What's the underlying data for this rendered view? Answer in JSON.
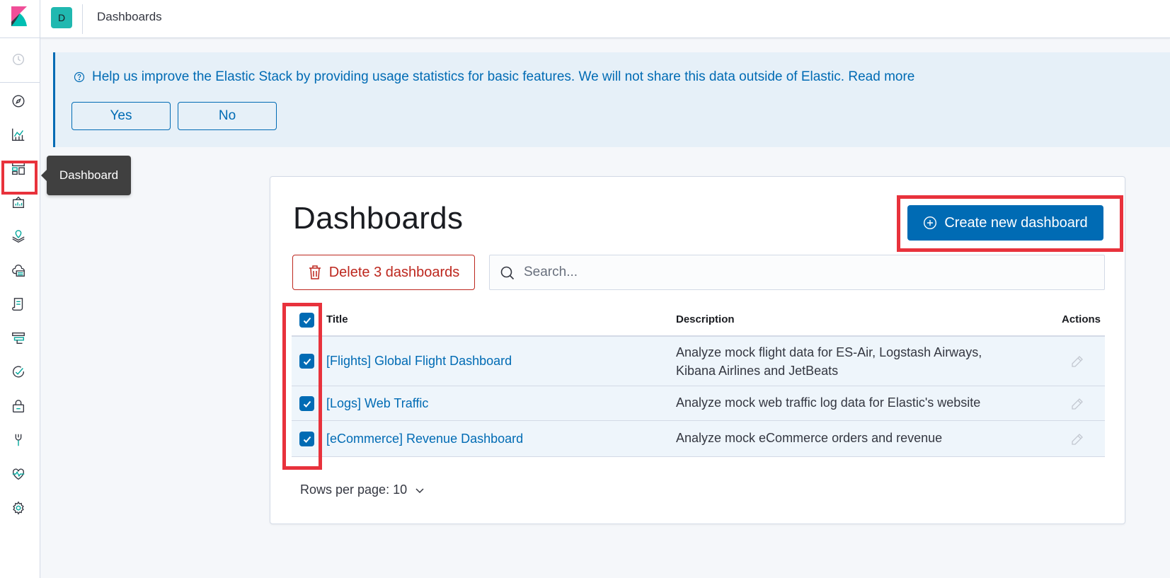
{
  "header": {
    "space_initial": "D",
    "breadcrumb": "Dashboards"
  },
  "sidenav": {
    "items": [
      {
        "icon": "recent-clock-icon"
      },
      {
        "icon": "discover-compass-icon"
      },
      {
        "icon": "visualize-chart-icon"
      },
      {
        "icon": "dashboard-icon"
      },
      {
        "icon": "canvas-icon"
      },
      {
        "icon": "maps-icon"
      },
      {
        "icon": "infrastructure-icon"
      },
      {
        "icon": "logs-icon"
      },
      {
        "icon": "apm-icon"
      },
      {
        "icon": "uptime-icon"
      },
      {
        "icon": "siem-lock-icon"
      },
      {
        "icon": "dev-tools-wrench-icon"
      },
      {
        "icon": "monitoring-heartbeat-icon"
      },
      {
        "icon": "management-gear-icon"
      }
    ],
    "tooltip": "Dashboard"
  },
  "callout": {
    "text": "Help us improve the Elastic Stack by providing usage statistics for basic features. We will not share this data outside of Elastic. Read more",
    "yes_label": "Yes",
    "no_label": "No"
  },
  "main": {
    "title": "Dashboards",
    "create_label": "Create new dashboard",
    "delete_label": "Delete 3 dashboards",
    "search_placeholder": "Search...",
    "columns": {
      "title": "Title",
      "description": "Description",
      "actions": "Actions"
    },
    "rows": [
      {
        "title": "[Flights] Global Flight Dashboard",
        "description": "Analyze mock flight data for ES-Air, Logstash Airways, Kibana Airlines and JetBeats",
        "checked": true
      },
      {
        "title": "[Logs] Web Traffic",
        "description": "Analyze mock web traffic log data for Elastic's website",
        "checked": true
      },
      {
        "title": "[eCommerce] Revenue Dashboard",
        "description": "Analyze mock eCommerce orders and revenue",
        "checked": true
      }
    ],
    "rows_per_page": "Rows per page: 10"
  },
  "colors": {
    "accent": "#006bb4",
    "danger": "#bd271e",
    "highlight": "#e8323c"
  }
}
